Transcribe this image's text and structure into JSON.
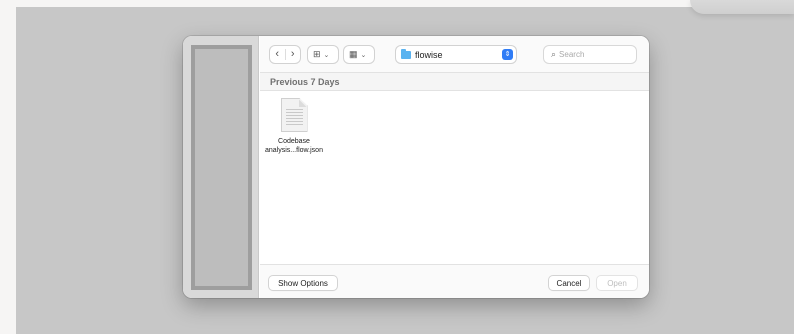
{
  "toolbar": {
    "back_glyph": "‹",
    "forward_glyph": "›",
    "view_glyph": "⊞",
    "group_glyph": "▦",
    "caret_glyph": "⌄",
    "folder_name": "flowise",
    "popup_glyph": "⇕",
    "search_glyph": "⌕",
    "search_placeholder": "Search"
  },
  "section": {
    "title": "Previous 7 Days"
  },
  "files": [
    {
      "name_line1": "Codebase",
      "name_line2": "analysis...flow.json",
      "icon": "json-document-icon"
    }
  ],
  "footer": {
    "show_options_label": "Show Options",
    "cancel_label": "Cancel",
    "open_label": "Open"
  },
  "colors": {
    "accent": "#2f7cf6",
    "folder": "#5ab3f0",
    "backdrop": "#c7c7c7",
    "sidebar_placeholder": "#bdbdbd",
    "disabled_text": "#bdbdbd"
  }
}
